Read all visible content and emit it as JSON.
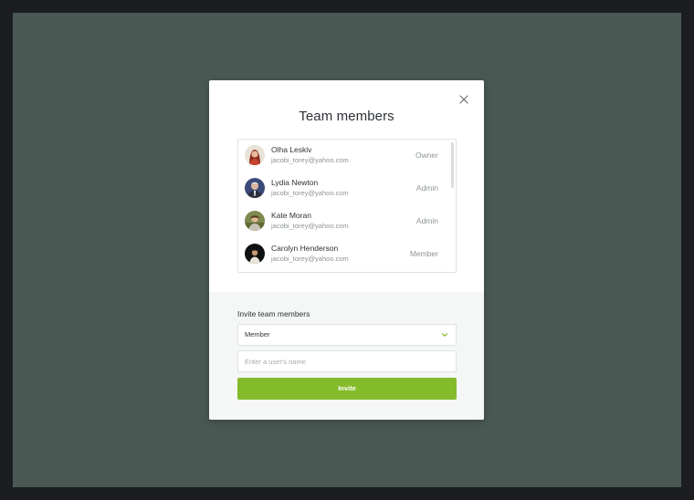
{
  "modal": {
    "title": "Team members",
    "close_icon": "close-icon"
  },
  "members": [
    {
      "name": "Olha Leskiv",
      "email": "jacobi_torey@yahoo.com",
      "role": "Owner",
      "avatar": "avatar-olha"
    },
    {
      "name": "Lydia Newton",
      "email": "jacobi_torey@yahoo.com",
      "role": "Admin",
      "avatar": "avatar-lydia"
    },
    {
      "name": "Kate Moran",
      "email": "jacobi_torey@yahoo.com",
      "role": "Admin",
      "avatar": "avatar-kate"
    },
    {
      "name": "Carolyn Henderson",
      "email": "jacobi_torey@yahoo.com",
      "role": "Member",
      "avatar": "avatar-carolyn"
    }
  ],
  "invite": {
    "label": "Invite team members",
    "role_select_value": "Member",
    "name_placeholder": "Enter a user's name",
    "button_label": "Invite"
  },
  "colors": {
    "accent": "#83bb2a",
    "backdrop": "#4a5853",
    "frame": "#1b1d21"
  }
}
